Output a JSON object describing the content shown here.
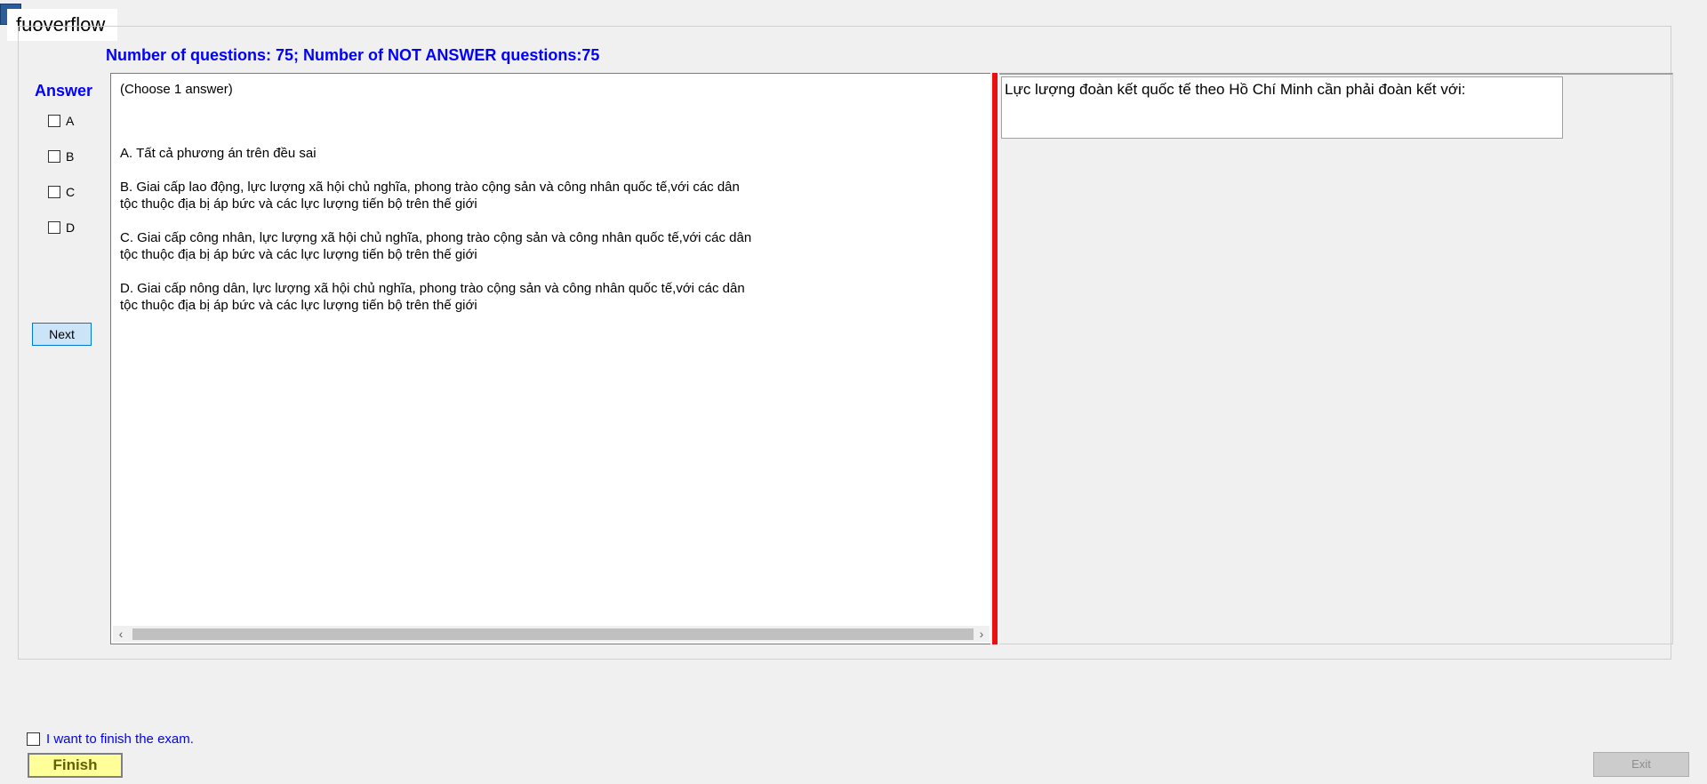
{
  "window": {
    "title": "fuoverflow"
  },
  "header": {
    "status_text": "Number of questions: 75; Number of NOT ANSWER questions:75"
  },
  "answer_panel": {
    "label": "Answer",
    "options": [
      "A",
      "B",
      "C",
      "D"
    ],
    "next_label": "Next"
  },
  "question": {
    "instruction": "(Choose 1 answer)",
    "options": [
      "A.  Tất cả phương án trên đều sai",
      "B.  Giai cấp lao động, lực lượng xã hội chủ nghĩa, phong trào cộng sản và công nhân quốc tế,với các dân\ntộc thuộc địa bị áp bức và các lực lượng tiến bộ trên thế giới",
      "C.  Giai cấp công nhân, lực lượng xã hội chủ nghĩa, phong trào cộng sản và công nhân quốc tế,với các dân\ntộc thuộc địa bị áp bức và các lực lượng tiến bộ trên thế giới",
      "D.  Giai cấp nông dân, lực lượng xã hội chủ nghĩa, phong trào cộng sản và công nhân quốc tế,với các dân\ntộc thuộc địa bị áp bức và các lực lượng tiến bộ trên thế giới"
    ],
    "stem": "Lực lượng đoàn kết quốc tế theo Hồ Chí Minh cần phải đoàn kết với:"
  },
  "footer": {
    "finish_check_label": "I want to finish the exam.",
    "finish_label": "Finish",
    "exit_label": "Exit"
  },
  "colors": {
    "label_blue": "#0000ff",
    "divider_red": "#e81010",
    "finish_yellow": "#ffff99"
  }
}
